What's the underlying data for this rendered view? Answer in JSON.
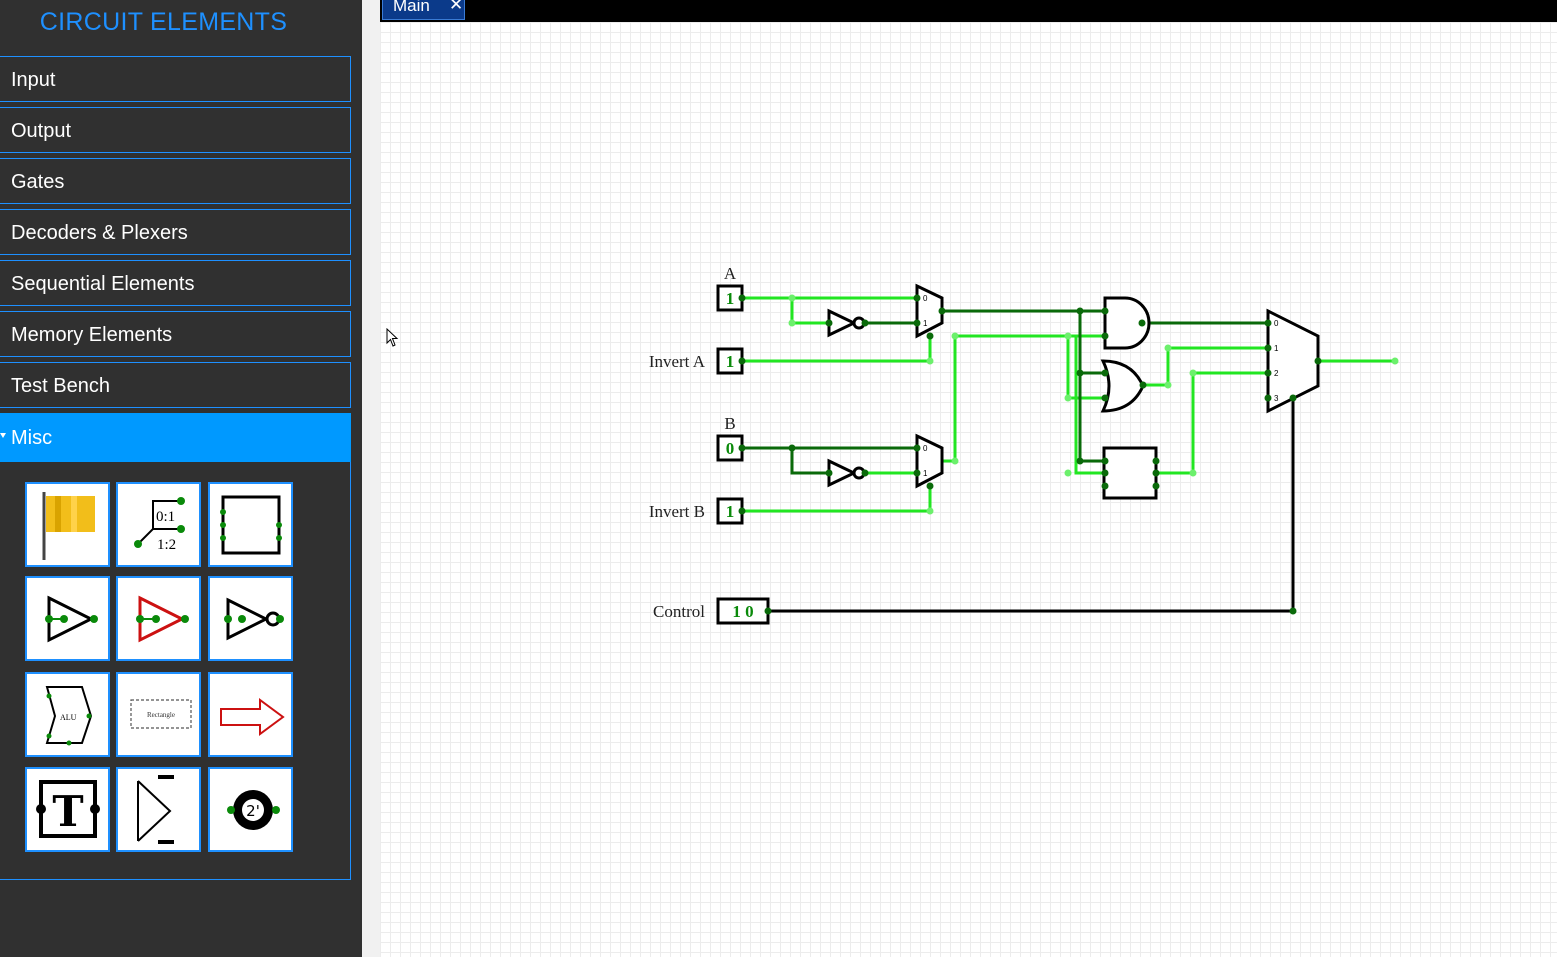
{
  "sidebar": {
    "title": "CIRCUIT ELEMENTS",
    "categories": [
      {
        "label": "Input"
      },
      {
        "label": "Output"
      },
      {
        "label": "Gates"
      },
      {
        "label": "Decoders & Plexers"
      },
      {
        "label": "Sequential Elements"
      },
      {
        "label": "Memory Elements"
      },
      {
        "label": "Test Bench"
      },
      {
        "label": "Misc",
        "expanded": true
      }
    ],
    "misc_items": [
      {
        "icon": "flag-icon"
      },
      {
        "icon": "splitter-icon",
        "labels": [
          "0:1",
          "1:2"
        ]
      },
      {
        "icon": "subcircuit-icon"
      },
      {
        "icon": "buffer-icon"
      },
      {
        "icon": "tristate-buffer-icon"
      },
      {
        "icon": "controlled-inverter-icon"
      },
      {
        "icon": "alu-icon",
        "label": "ALU"
      },
      {
        "icon": "rectangle-icon",
        "label": "Rectangle"
      },
      {
        "icon": "arrow-icon"
      },
      {
        "icon": "text-icon",
        "label": "T"
      },
      {
        "icon": "tunnel-icon"
      },
      {
        "icon": "two-complement-icon",
        "label": "2'"
      }
    ]
  },
  "tabs": [
    {
      "label": "Main",
      "close": "✕"
    }
  ],
  "circuit": {
    "inputs": {
      "a": {
        "label": "A",
        "value": "1"
      },
      "invert_a": {
        "label": "Invert A",
        "value": "1"
      },
      "b": {
        "label": "B",
        "value": "0"
      },
      "invert_b": {
        "label": "Invert B",
        "value": "1"
      },
      "control": {
        "label": "Control",
        "value": "1 0"
      }
    },
    "mux_pins": {
      "in0": "0",
      "in1": "1",
      "in2": "2",
      "in3": "3"
    },
    "colors": {
      "wire_on": "#22e622",
      "wire_off": "#0a6a0a",
      "wire_bus": "#000000",
      "accent": "#1e90ff",
      "active_category": "#0099ff"
    }
  }
}
